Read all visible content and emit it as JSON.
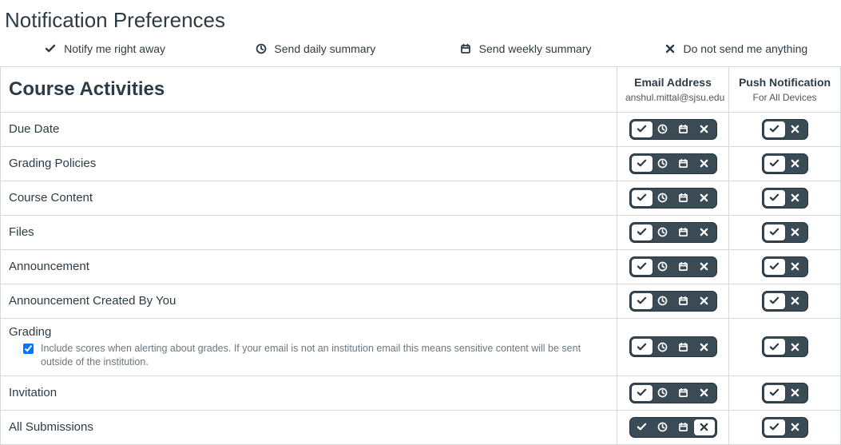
{
  "title": "Notification Preferences",
  "legend": {
    "immediately": "Notify me right away",
    "daily": "Send daily summary",
    "weekly": "Send weekly summary",
    "never": "Do not send me anything"
  },
  "section_title": "Course Activities",
  "columns": {
    "email": {
      "title": "Email Address",
      "sub": "anshul.mittal@sjsu.edu"
    },
    "push": {
      "title": "Push Notification",
      "sub": "For All Devices"
    }
  },
  "rows": [
    {
      "label": "Due Date",
      "email_sel": "immediately",
      "push_sel": "immediately"
    },
    {
      "label": "Grading Policies",
      "email_sel": "immediately",
      "push_sel": "immediately"
    },
    {
      "label": "Course Content",
      "email_sel": "immediately",
      "push_sel": "immediately"
    },
    {
      "label": "Files",
      "email_sel": "immediately",
      "push_sel": "immediately"
    },
    {
      "label": "Announcement",
      "email_sel": "immediately",
      "push_sel": "immediately"
    },
    {
      "label": "Announcement Created By You",
      "email_sel": "immediately",
      "push_sel": "immediately"
    },
    {
      "label": "Grading",
      "note": "Include scores when alerting about grades. If your email is not an institution email this means sensitive content will be sent outside of the institution.",
      "note_checked": true,
      "email_sel": "immediately",
      "push_sel": "immediately"
    },
    {
      "label": "Invitation",
      "email_sel": "immediately",
      "push_sel": "immediately"
    },
    {
      "label": "All Submissions",
      "email_sel": "never",
      "push_sel": "immediately"
    }
  ]
}
